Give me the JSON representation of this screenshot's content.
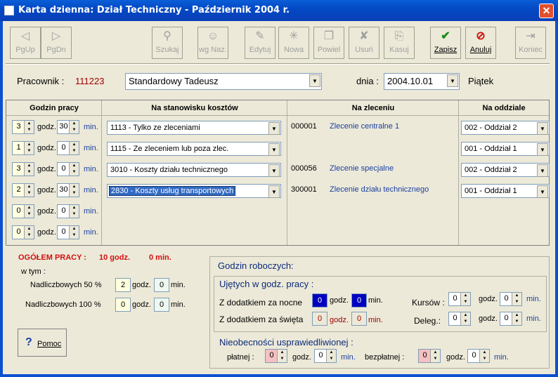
{
  "window": {
    "title": "Karta dzienna: Dział Techniczny - Październik 2004 r.",
    "close": "✕"
  },
  "toolbar": [
    {
      "label": "PgUp",
      "icon": "◁",
      "enabled": false
    },
    {
      "label": "PgDn",
      "icon": "▷",
      "enabled": false
    },
    {
      "label": "Szukaj",
      "icon": "⚲",
      "enabled": false
    },
    {
      "label": "wg Naz.",
      "icon": "☺",
      "enabled": false
    },
    {
      "label": "Edytuj",
      "icon": "✎",
      "enabled": false
    },
    {
      "label": "Nowa",
      "icon": "✳",
      "enabled": false
    },
    {
      "label": "Powiel",
      "icon": "❐",
      "enabled": false
    },
    {
      "label": "Usuń",
      "icon": "✘",
      "enabled": false
    },
    {
      "label": "Kasuj",
      "icon": "⎘",
      "enabled": false
    },
    {
      "label": "Zapisz",
      "icon": "✔",
      "enabled": true,
      "color": "#1a8a1a"
    },
    {
      "label": "Anuluj",
      "icon": "⊘",
      "enabled": true,
      "color": "#d01010"
    },
    {
      "label": "Koniec",
      "icon": "⇥",
      "enabled": false
    }
  ],
  "employee": {
    "label": "Pracownik :",
    "id": "111223",
    "name": "Standardowy Tadeusz",
    "date_label": "dnia :",
    "date": "2004.10.01",
    "weekday": "Piątek"
  },
  "grid": {
    "headers": [
      "Godzin pracy",
      "Na stanowisku kosztów",
      "Na zleceniu",
      "Na oddziale"
    ],
    "unit_h": "godz.",
    "unit_m": "min.",
    "rows": [
      {
        "h": "3",
        "m": "30",
        "cost": "1113  - Tylko ze zleceniami",
        "order_no": "000001",
        "order": "Zlecenie centralne 1",
        "dept": "002 - Oddział 2"
      },
      {
        "h": "1",
        "m": "0",
        "cost": "1115  - Ze zleceniem lub poza zlec.",
        "order_no": "",
        "order": "",
        "dept": "001 - Oddział 1"
      },
      {
        "h": "3",
        "m": "0",
        "cost": "3010  - Koszty działu technicznego",
        "order_no": "000056",
        "order": "Zlecenie specjalne",
        "dept": "002 - Oddział 2"
      },
      {
        "h": "2",
        "m": "30",
        "cost": "2830  - Koszty usług transportowych",
        "order_no": "300001",
        "order": "Zlecenie działu technicznego",
        "dept": "001 - Oddział 1"
      },
      {
        "h": "0",
        "m": "0",
        "cost": "",
        "order_no": "",
        "order": "",
        "dept": ""
      },
      {
        "h": "0",
        "m": "0",
        "cost": "",
        "order_no": "",
        "order": "",
        "dept": ""
      }
    ]
  },
  "summary": {
    "total_label": "OGÓŁEM PRACY :",
    "total_h": "10 godz.",
    "total_m": "0 min.",
    "wtym": "w tym :",
    "ot50_label": "Nadliczbowych 50 %",
    "ot50_h": "2",
    "ot50_m": "0",
    "ot100_label": "Nadliczbowych 100 %",
    "ot100_h": "0",
    "ot100_m": "0"
  },
  "help": {
    "label": "Pomoc",
    "icon": "?"
  },
  "roboczych": {
    "title": "Godzin roboczych:",
    "ujete": "Ujętych w godz. pracy :",
    "noc_label": "Z dodatkiem za nocne",
    "noc_h": "0",
    "noc_m": "0",
    "swieta_label": "Z dodatkiem za święta",
    "sw_h": "0",
    "sw_m": "0",
    "kursow_label": "Kursów :",
    "kursow_h": "0",
    "kursow_m": "0",
    "deleg_label": "Deleg.:",
    "deleg_h": "0",
    "deleg_m": "0",
    "nieob": "Nieobecności usprawiedliwionej :",
    "platnej": "płatnej :",
    "pl_h": "0",
    "pl_m": "0",
    "bezplatnej": "bezpłatnej :",
    "bz_h": "0",
    "bz_m": "0"
  }
}
